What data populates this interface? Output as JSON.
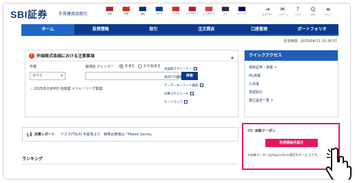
{
  "header": {
    "logo": "SBI証券",
    "logo_sub": "外貨建商品取引",
    "flags": [
      {
        "name": "米国",
        "color": "#b22234"
      },
      {
        "name": "中国",
        "color": "#de2910"
      },
      {
        "name": "韓国",
        "color": "#003478"
      },
      {
        "name": "ロシア",
        "color": "#0039a6"
      },
      {
        "name": "ベトナム",
        "color": "#da251d"
      },
      {
        "name": "インドネシア",
        "color": "#ce1126"
      },
      {
        "name": "シンガポール",
        "color": "#ef3340"
      },
      {
        "name": "タイ",
        "color": "#2d2a4a"
      },
      {
        "name": "マレーシア",
        "color": "#010066"
      }
    ],
    "tools": [
      {
        "icon": "logout-icon",
        "glyph": "⇥",
        "name": "ログアウト"
      },
      {
        "icon": "mail-icon",
        "glyph": "✉",
        "name": "メッセージ"
      },
      {
        "icon": "help-icon",
        "glyph": "?",
        "name": "ヘルプ"
      },
      {
        "icon": "qa-icon",
        "glyph": "Q",
        "name": "Q&A"
      },
      {
        "icon": "menu-icon",
        "glyph": "≡",
        "name": "メニュー"
      }
    ]
  },
  "nav": {
    "items": [
      "ホーム",
      "投資情報",
      "取引",
      "注文照会",
      "口座管理",
      "ポートフォリオ"
    ],
    "active_index": 0
  },
  "date_text": "日本時間：2025/04/11 15:38:37",
  "notice": {
    "title": "外国株式各国における注意事項",
    "market_label": "市場",
    "market_value": "すべて",
    "ticker_label": "銘柄名 ティッカー",
    "radio_contains": "を含む",
    "radio_starts": "から始まる",
    "search_button": "検索",
    "ipo_text": "2025年の米IPO 全関連 メジャーリーグ関連",
    "links": [
      "米国株スクリーナー",
      "海外ETF検索ツール",
      "テーマ・キーワード検索",
      "決算スケジュール",
      "ヒートマップ"
    ]
  },
  "quick": {
    "title": "クイックアクセス",
    "items": [
      "保有証券・資産 >",
      "My資産",
      "入出金",
      "為替取引",
      "積立設定一覧 >"
    ]
  },
  "report": {
    "title": "決算レポート",
    "text": "テスラ(TSLA) 利益率より　納車台数増は「Makes Sense」"
  },
  "ranking_title": "ランキング",
  "coupon": {
    "title": "米株クーポン",
    "button": "利用開始手続き",
    "note": "※米株クーポンはAlpacaTech運営のサービスです。"
  }
}
